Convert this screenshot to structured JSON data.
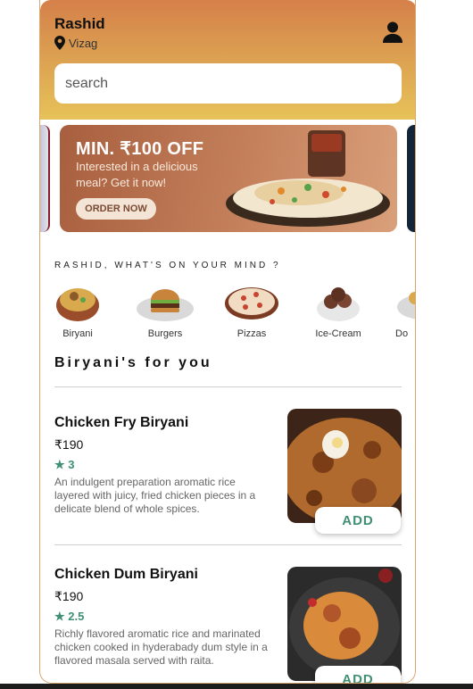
{
  "header": {
    "user_name": "Rashid",
    "location": "Vizag",
    "profile_icon": "user-icon",
    "location_icon": "pin-icon"
  },
  "search": {
    "placeholder": "search"
  },
  "banner": {
    "title": "MIN. ₹100 OFF",
    "subtitle": "Interested in a delicious meal? Get it now!",
    "cta": "ORDER NOW"
  },
  "mind": {
    "heading": "RASHID, WHAT'S ON YOUR MIND ?"
  },
  "categories": [
    {
      "label": "Biryani"
    },
    {
      "label": "Burgers"
    },
    {
      "label": "Pizzas"
    },
    {
      "label": "Ice-Cream"
    },
    {
      "label": "Do"
    }
  ],
  "section": {
    "title": "Biryani's for you"
  },
  "items": [
    {
      "name": "Chicken Fry Biryani",
      "price": "₹190",
      "rating": "★ 3",
      "description": "An indulgent preparation aromatic rice layered with juicy, fried chicken pieces in a delicate blend of whole spices.",
      "add": "ADD"
    },
    {
      "name": "Chicken Dum Biryani",
      "price": "₹190",
      "rating": "★ 2.5",
      "description": "Richly flavored aromatic rice and marinated chicken cooked in hyderabady dum style in a flavored masala served with raita.",
      "add": "ADD"
    }
  ],
  "colors": {
    "accent_green": "#3f8f72",
    "header_top": "#d5804a",
    "header_bottom": "#e7c259"
  }
}
